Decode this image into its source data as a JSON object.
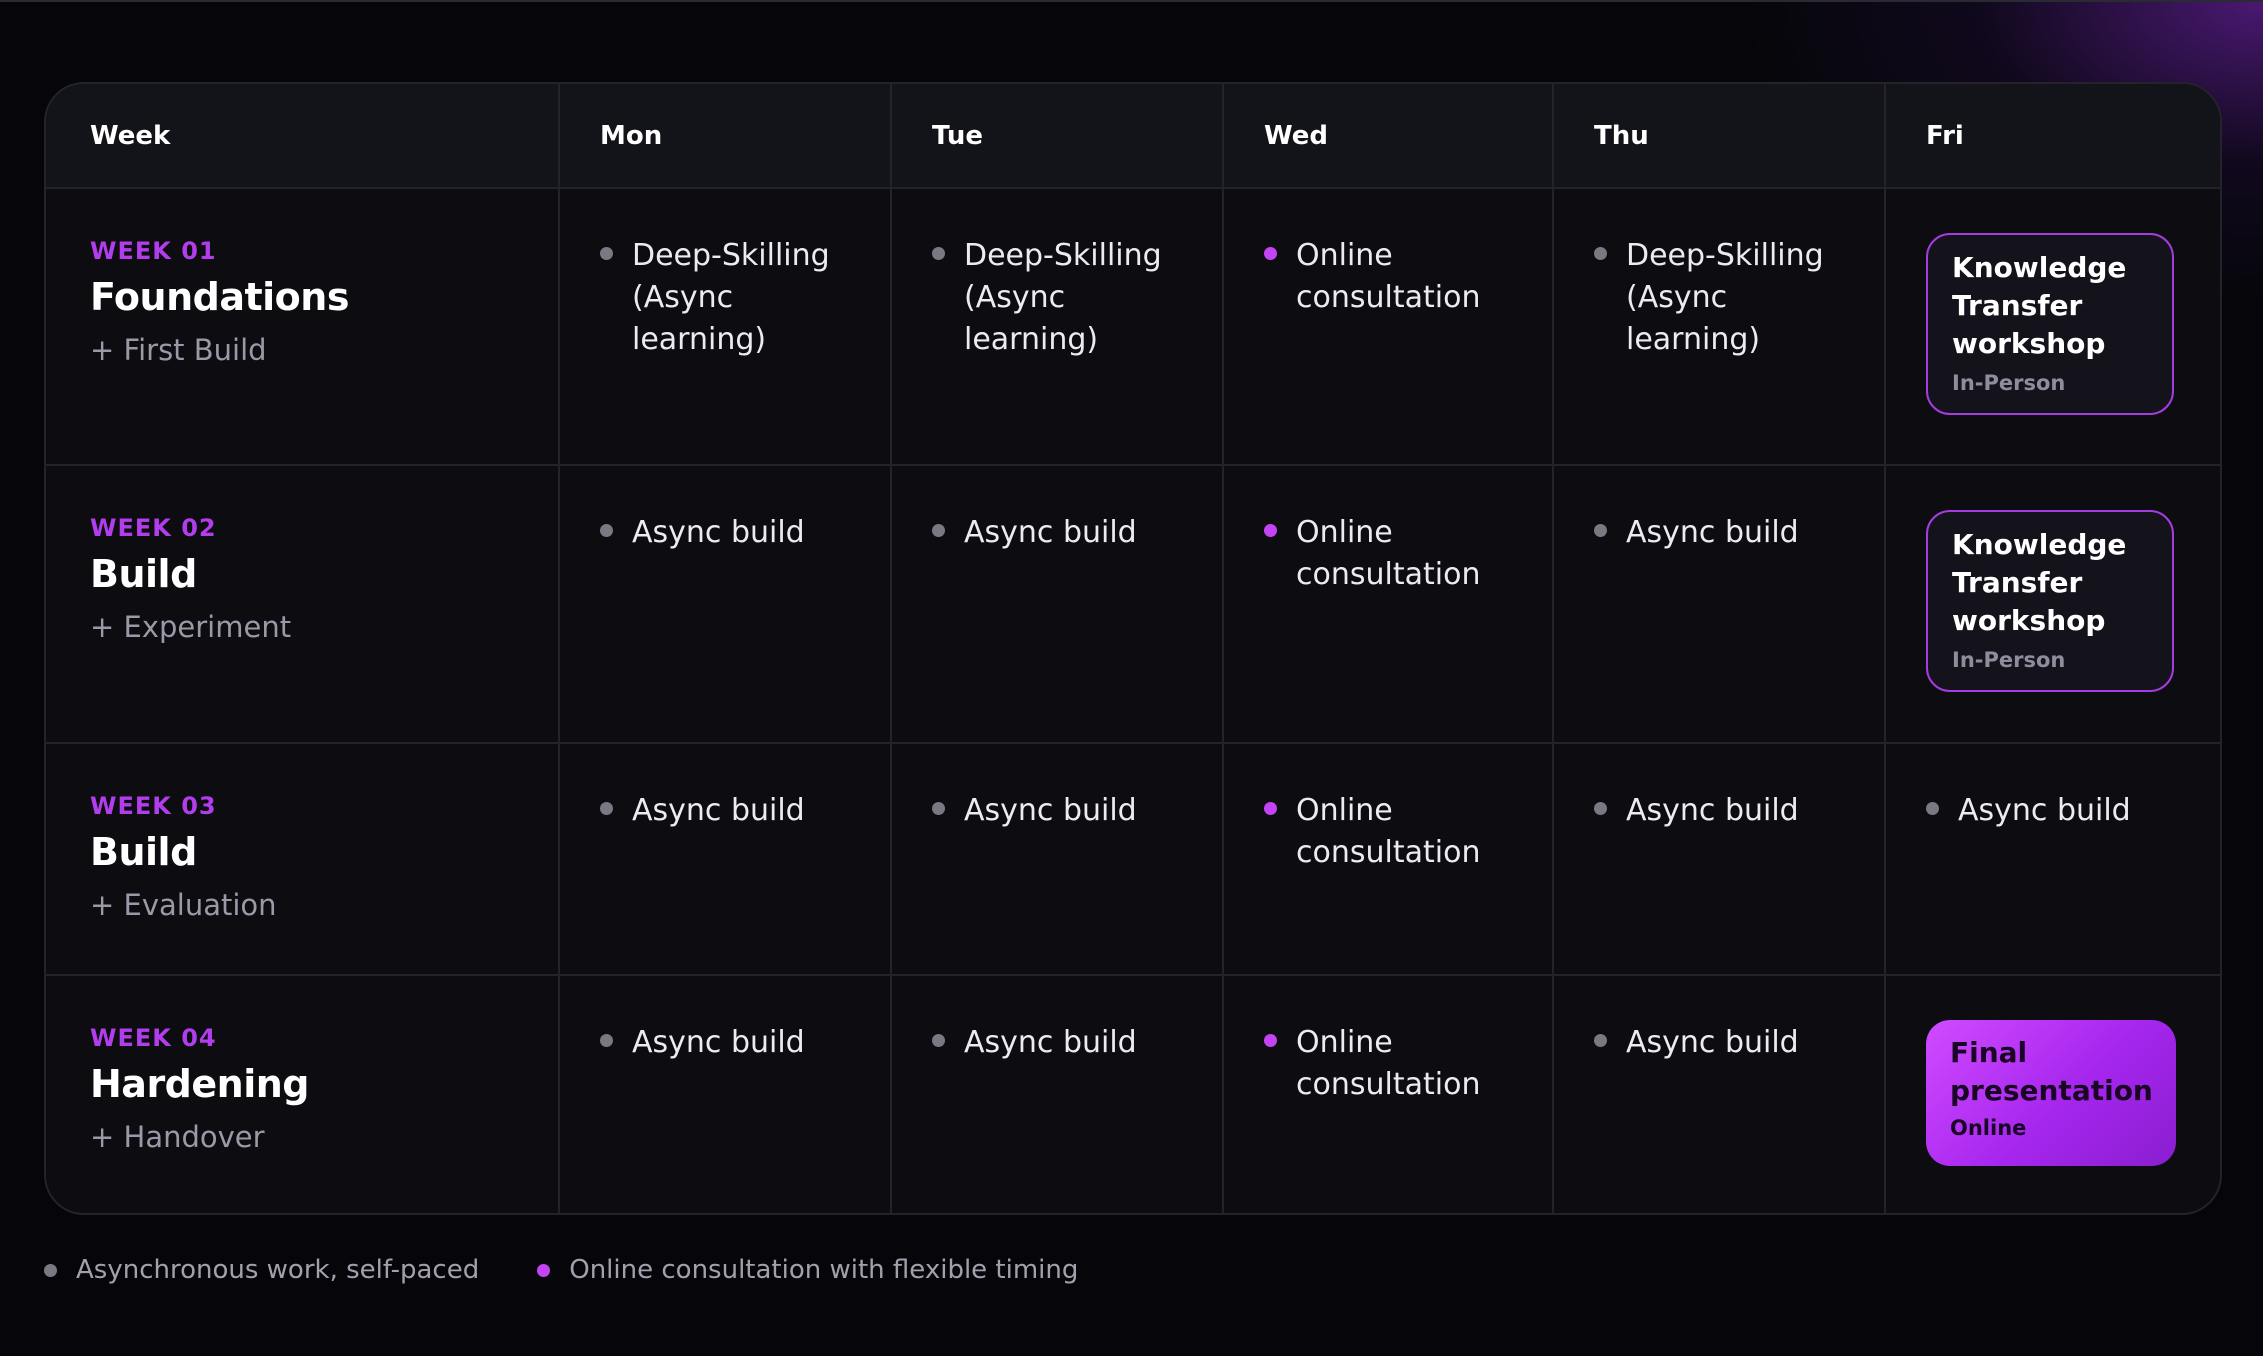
{
  "header": [
    "Week",
    "Mon",
    "Tue",
    "Wed",
    "Thu",
    "Fri"
  ],
  "weeks": [
    {
      "num": "WEEK 01",
      "title": "Foundations",
      "sub": "+ First Build",
      "days": [
        {
          "kind": "async",
          "text": "Deep-Skilling (Async learning)"
        },
        {
          "kind": "async",
          "text": "Deep-Skilling (Async learning)"
        },
        {
          "kind": "online",
          "text": "Online consultation"
        },
        {
          "kind": "async",
          "text": "Deep-Skilling (Async learning)"
        },
        {
          "kind": "workshop",
          "text": "Knowledge Transfer workshop",
          "sub": "In-Person"
        }
      ]
    },
    {
      "num": "WEEK 02",
      "title": "Build",
      "sub": "+ Experiment",
      "days": [
        {
          "kind": "async",
          "text": "Async build"
        },
        {
          "kind": "async",
          "text": "Async build"
        },
        {
          "kind": "online",
          "text": "Online consultation"
        },
        {
          "kind": "async",
          "text": "Async build"
        },
        {
          "kind": "workshop",
          "text": "Knowledge Transfer workshop",
          "sub": "In-Person"
        }
      ]
    },
    {
      "num": "WEEK 03",
      "title": "Build",
      "sub": "+ Evaluation",
      "days": [
        {
          "kind": "async",
          "text": "Async build"
        },
        {
          "kind": "async",
          "text": "Async build"
        },
        {
          "kind": "online",
          "text": "Online consultation"
        },
        {
          "kind": "async",
          "text": "Async build"
        },
        {
          "kind": "async",
          "text": "Async build"
        }
      ]
    },
    {
      "num": "WEEK 04",
      "title": "Hardening",
      "sub": "+ Handover",
      "days": [
        {
          "kind": "async",
          "text": "Async build"
        },
        {
          "kind": "async",
          "text": "Async build"
        },
        {
          "kind": "online",
          "text": "Online consultation"
        },
        {
          "kind": "async",
          "text": "Async build"
        },
        {
          "kind": "final",
          "text": "Final presentation",
          "sub": "Online"
        }
      ]
    }
  ],
  "legend": [
    {
      "kind": "async",
      "text": "Asynchronous work, self-paced"
    },
    {
      "kind": "online",
      "text": "Online consultation with flexible timing"
    }
  ],
  "colors": {
    "accent": "#b23dec",
    "async_dot": "#7a7883",
    "online_dot": "#c443f4",
    "background": "#06060a"
  }
}
